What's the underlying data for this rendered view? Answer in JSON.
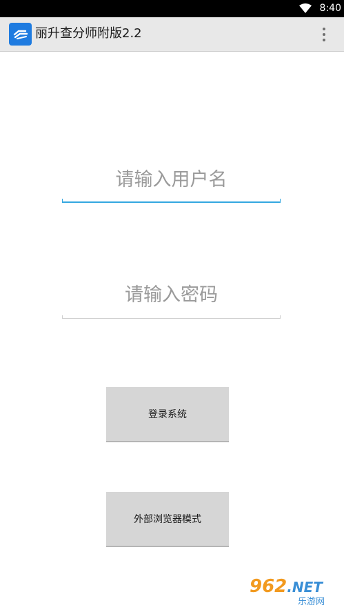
{
  "status_bar": {
    "time": "8:40",
    "wifi_icon": "wifi-icon",
    "battery_icon": "battery-icon"
  },
  "action_bar": {
    "app_icon": "app-logo-icon",
    "title": "丽升查分师附版2.2",
    "menu_icon": "overflow-menu-icon"
  },
  "login_form": {
    "username_placeholder": "请输入用户名",
    "username_value": "",
    "password_placeholder": "请输入密码",
    "password_value": ""
  },
  "buttons": {
    "login_label": "登录系统",
    "browser_mode_label": "外部浏览器模式"
  },
  "watermark": {
    "main_text": "962",
    "suffix_text": ".NET",
    "sub_text": "乐游网"
  },
  "colors": {
    "accent": "#33a7e0",
    "action_bar_bg": "#e8e8e8",
    "button_bg": "#d6d6d6",
    "app_icon_bg": "#1e7be0"
  }
}
